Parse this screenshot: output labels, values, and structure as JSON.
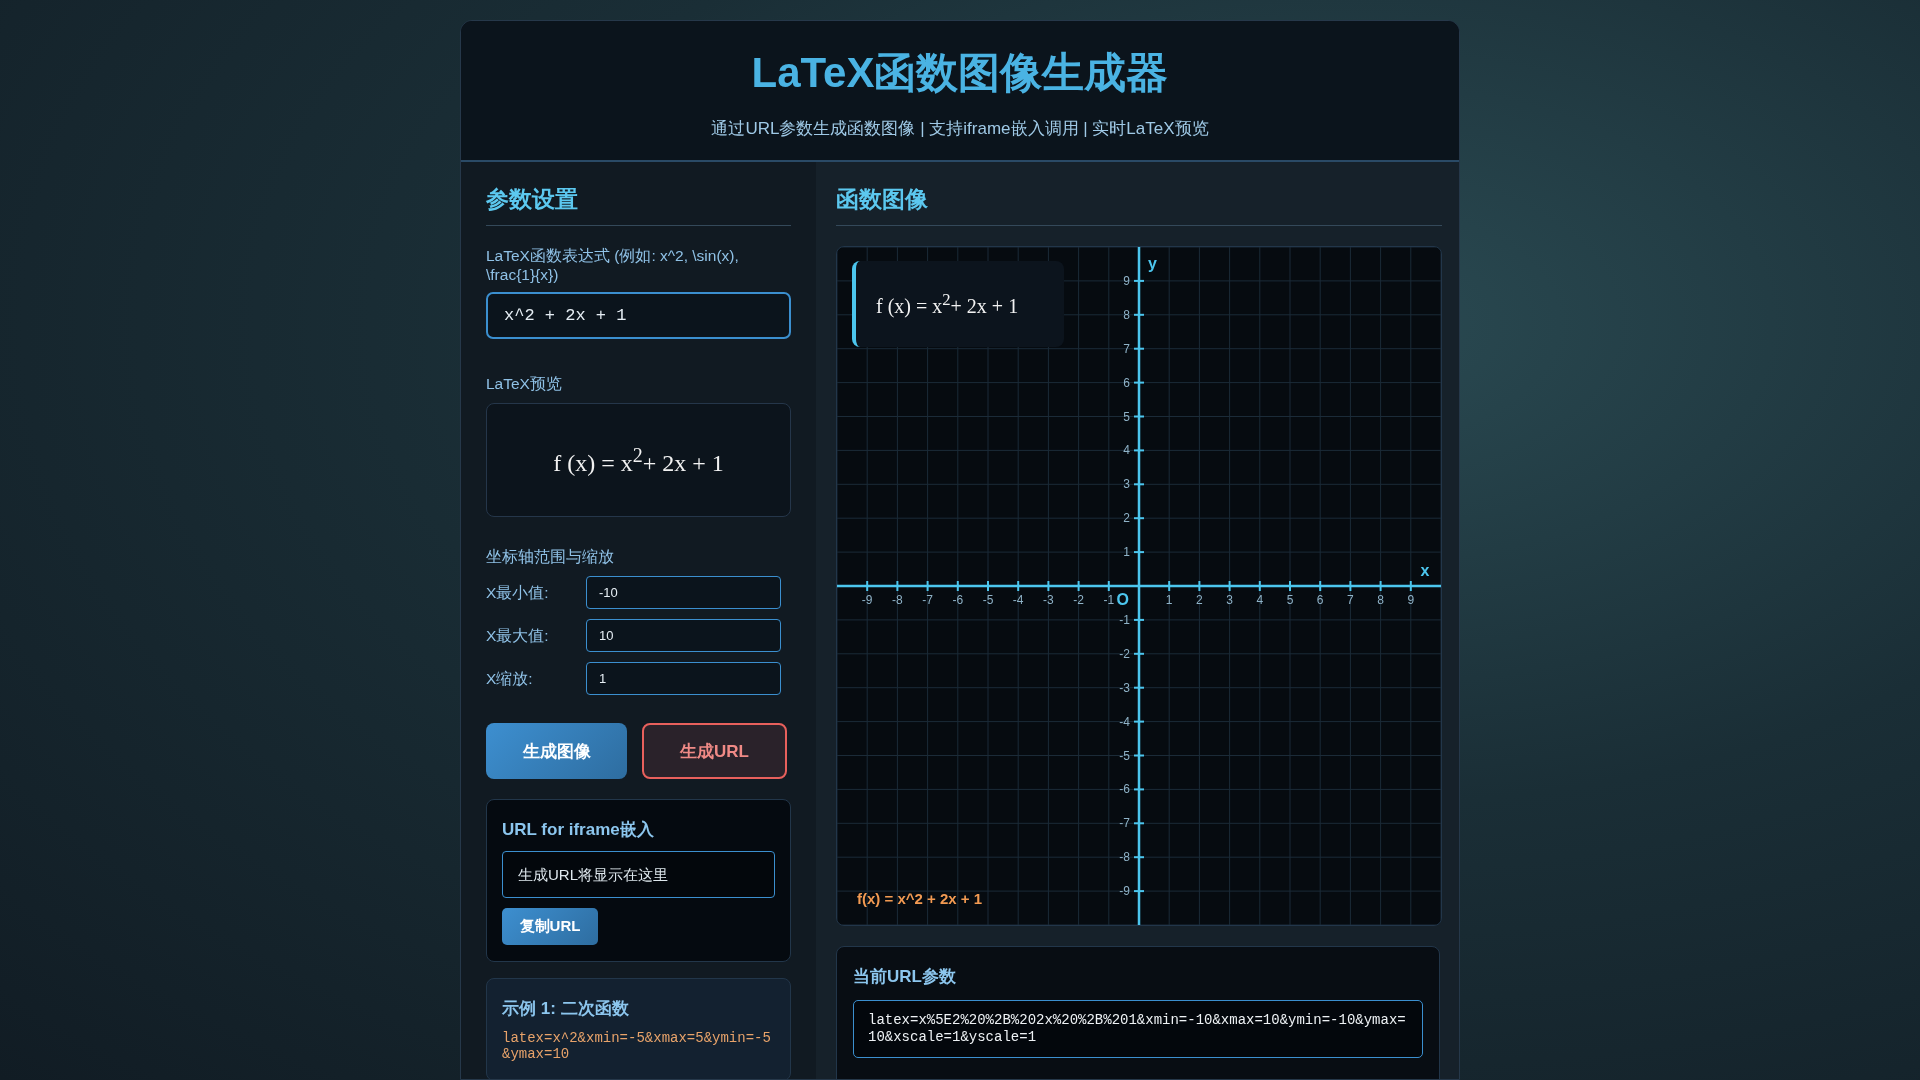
{
  "header": {
    "title": "LaTeX函数图像生成器",
    "subtitle": "通过URL参数生成函数图像 | 支持iframe嵌入调用 | 实时LaTeX预览"
  },
  "settings": {
    "title": "参数设置",
    "expression_label": "LaTeX函数表达式 (例如: x^2, \\sin(x), \\frac{1}{x})",
    "expression_value": "x^2 + 2x + 1",
    "preview_label": "LaTeX预览",
    "preview_formula": "f (x) = x$^{2}$+ 2x + 1",
    "axes_label": "坐标轴范围与缩放",
    "axis_fields": [
      {
        "label": "X最小值:",
        "value": "-10"
      },
      {
        "label": "X最大值:",
        "value": "10"
      },
      {
        "label": "X缩放:",
        "value": "1"
      }
    ],
    "buttons": [
      {
        "label": "生成图像",
        "kind": "primary"
      },
      {
        "label": "生成URL",
        "kind": "outline"
      }
    ],
    "url_card": {
      "title": "URL for iframe嵌入",
      "placeholder": "生成URL将显示在这里",
      "copy_button": "复制URL"
    },
    "example": {
      "title": "示例 1: 二次函数",
      "code": "latex=x^2&xmin=-5&xmax=5&ymin=-5&ymax=10"
    }
  },
  "graph": {
    "title": "函数图像",
    "formula_overlay": "f (x) = x$^{2}$+ 2x + 1",
    "function_label": "f(x) = x^2 + 2x + 1",
    "origin_label": "O",
    "chart_data": {
      "type": "line",
      "grid": true,
      "xlabel": "x",
      "ylabel": "y",
      "xlim": [
        -10,
        10
      ],
      "ylim": [
        -10,
        10
      ],
      "xticks": [
        -9,
        -8,
        -7,
        -6,
        -5,
        -4,
        -3,
        -2,
        -1,
        1,
        2,
        3,
        4,
        5,
        6,
        7,
        8,
        9
      ],
      "yticks": [
        -9,
        -8,
        -7,
        -6,
        -5,
        -4,
        -3,
        -2,
        -1,
        1,
        2,
        3,
        4,
        5,
        6,
        7,
        8,
        9
      ]
    }
  },
  "url_params": {
    "title": "当前URL参数",
    "value": "latex=x%5E2%20%2B%202x%20%2B%201&xmin=-10&xmax=10&ymin=-10&ymax=10&xscale=1&yscale=1"
  }
}
